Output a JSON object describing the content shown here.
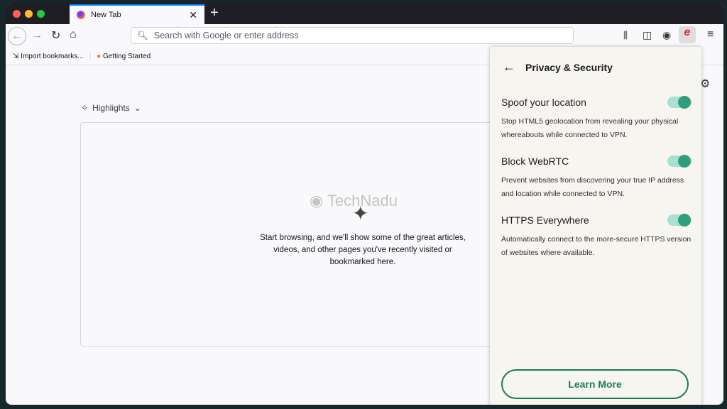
{
  "tab": {
    "title": "New Tab"
  },
  "toolbar": {
    "url_placeholder": "Search with Google or enter address"
  },
  "bookmarks": [
    "Import bookmarks...",
    "Getting Started"
  ],
  "content": {
    "section": "Highlights",
    "empty_message": "Start browsing, and we'll show some of the great articles, videos, and other pages you've recently visited or bookmarked here.",
    "watermark": "TechNadu"
  },
  "panel": {
    "title": "Privacy & Security",
    "options": [
      {
        "title": "Spoof your location",
        "description": "Stop HTML5 geolocation from revealing your physical whereabouts while connected to VPN.",
        "enabled": true
      },
      {
        "title": "Block WebRTC",
        "description": "Prevent websites from discovering your true IP address and location while connected to VPN.",
        "enabled": true
      },
      {
        "title": "HTTPS Everywhere",
        "description": "Automatically connect to the more-secure HTTPS version of websites where available.",
        "enabled": true
      }
    ],
    "learn_more": "Learn More",
    "accent": "#2e9e7b"
  }
}
